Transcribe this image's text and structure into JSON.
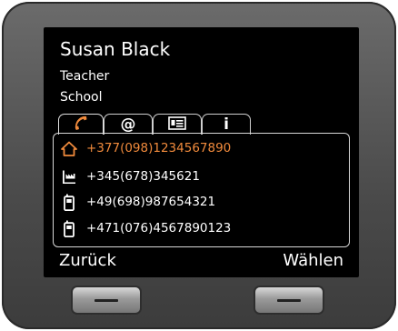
{
  "contact": {
    "name": "Susan Black",
    "title": "Teacher",
    "company": "School"
  },
  "tabs": [
    {
      "icon": "phone-icon",
      "glyph": "",
      "active": true
    },
    {
      "icon": "at-icon",
      "glyph": "@",
      "active": false
    },
    {
      "icon": "vcard-icon",
      "glyph": "",
      "active": false
    },
    {
      "icon": "info-icon",
      "glyph": "i",
      "active": false
    }
  ],
  "numbers": [
    {
      "icon": "home-icon",
      "value": "+377(098)1234567890",
      "selected": true
    },
    {
      "icon": "office-icon",
      "value": "+345(678)345621",
      "selected": false
    },
    {
      "icon": "mobile-icon",
      "value": "+49(698)987654321",
      "selected": false
    },
    {
      "icon": "mobile-icon",
      "value": "+471(076)4567890123",
      "selected": false
    }
  ],
  "softkeys": {
    "left": "Zurück",
    "right": "Wählen"
  },
  "colors": {
    "accent": "#f08a3c",
    "screen_bg": "#000000",
    "text": "#ffffff",
    "bezel": "#555555"
  }
}
